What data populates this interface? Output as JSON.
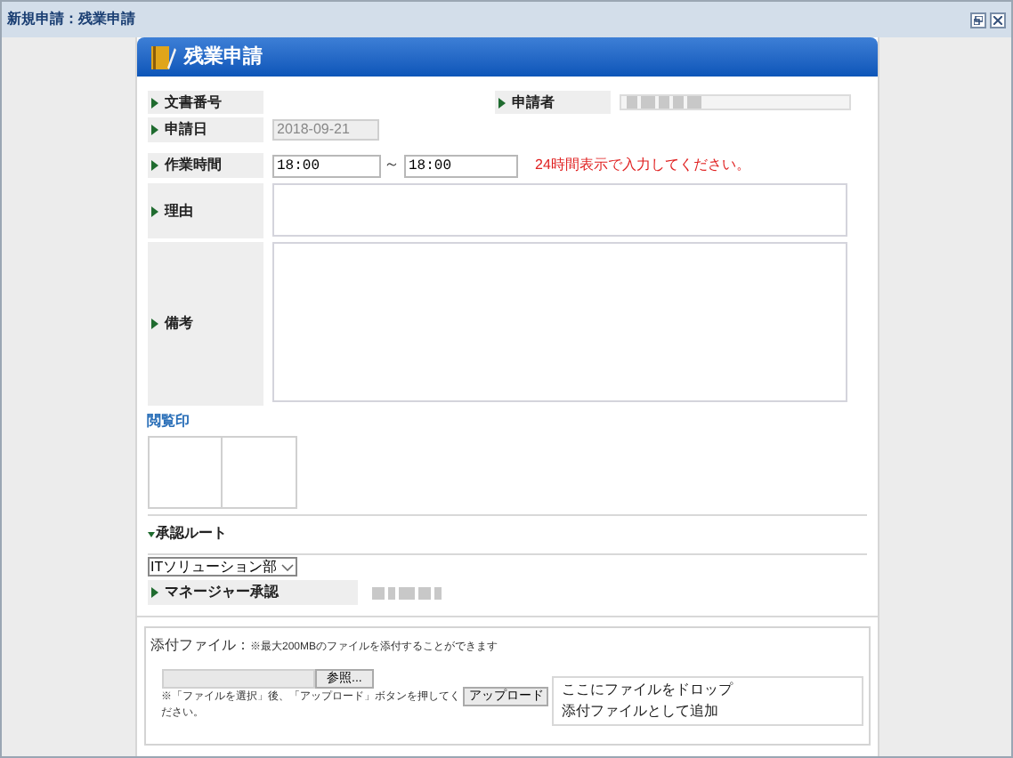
{
  "window": {
    "title": "新規申請：残業申請"
  },
  "form": {
    "title": "残業申請",
    "fields": [
      {
        "label": "文書番号"
      },
      {
        "label": "申請者"
      },
      {
        "label": "申請日",
        "value": "2018-09-21",
        "disabled": true
      },
      {
        "label": "作業時間",
        "from": "18:00",
        "separator": "～",
        "to": "18:00",
        "hint": "24時間表示で入力してください。"
      },
      {
        "label": "理由"
      },
      {
        "label": "備考"
      }
    ]
  },
  "stamps": {
    "title": "閲覧印"
  },
  "approval": {
    "title": "承認ルート",
    "expanded": true,
    "department": "ITソリューション部",
    "steps": [
      {
        "label": "マネージャー承認"
      }
    ]
  },
  "attachment": {
    "label": "添付ファイル：",
    "note": "※最大200MBのファイルを添付することができます",
    "browse": "参照...",
    "instruction": "※「ファイルを選択」後、「アップロード」ボタンを押してください。",
    "upload": "アップロード",
    "drop_lines": [
      "ここにファイルをドロップ",
      "添付ファイルとして追加"
    ]
  }
}
